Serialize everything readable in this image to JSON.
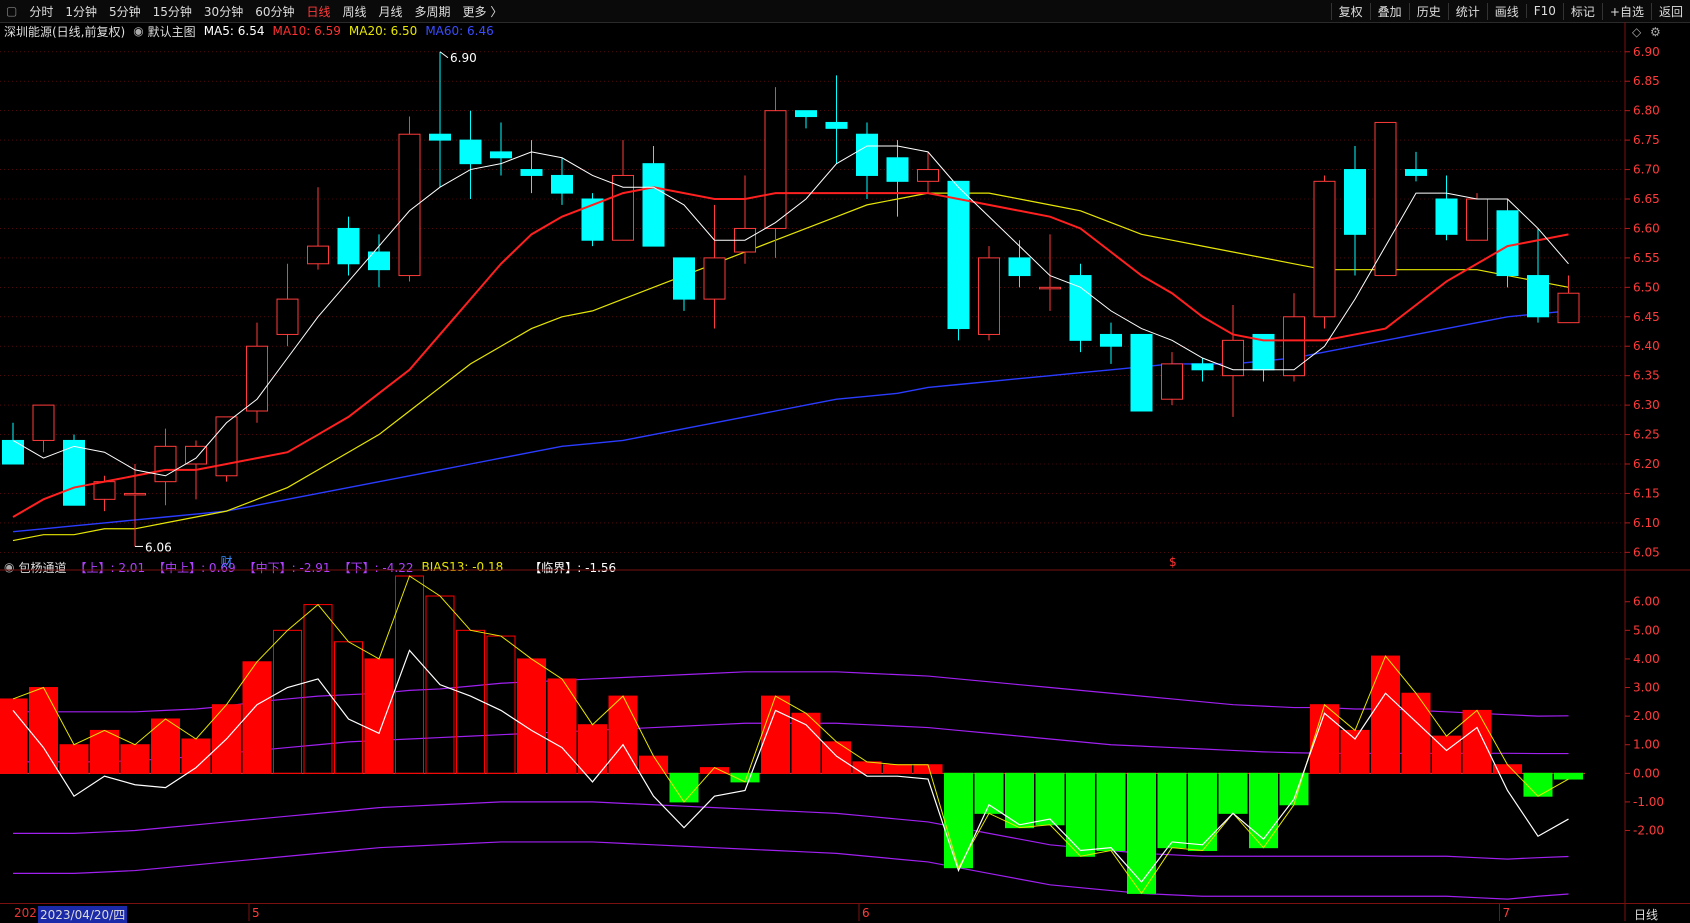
{
  "toolbar": {
    "periods": [
      "分时",
      "1分钟",
      "5分钟",
      "15分钟",
      "30分钟",
      "60分钟",
      "日线",
      "周线",
      "月线",
      "多周期",
      "更多 〉"
    ],
    "active": "日线",
    "right": [
      "复权",
      "叠加",
      "历史",
      "统计",
      "画线",
      "F10",
      "标记",
      "+自选",
      "返回"
    ]
  },
  "legend_main": {
    "name": "深圳能源(日线,前复权)",
    "main_label": "默认主图",
    "ma5": "MA5: 6.54",
    "ma10": "MA10: 6.59",
    "ma20": "MA20: 6.50",
    "ma60": "MA60: 6.46"
  },
  "legend_sub": {
    "name": "包杨通道",
    "up": "【上】: 2.01",
    "midup": "【中上】: 0.69",
    "middown": "【中下】: -2.91",
    "down": "【下】: -4.22",
    "bias": "BIAS13: -0.18",
    "critical": "【临界】: -1.56"
  },
  "dates": {
    "start": "202",
    "selected": "2023/04/20/四",
    "ticks": [
      "5",
      "6",
      "7"
    ],
    "mode": "日线"
  },
  "marks": {
    "high": "6.90",
    "low": "6.06",
    "fin": "财",
    "div": "$"
  },
  "colors": {
    "up": "#ff3b3b",
    "down": "#00ffff",
    "ma5": "#ffffff",
    "ma10": "#ff2020",
    "ma20": "#e6e600",
    "ma60": "#2a3cff",
    "bar_pos": "#ff0000",
    "bar_neg": "#00ff00",
    "band": "#a020f0"
  },
  "chart_data": [
    {
      "type": "candlestick",
      "yticks": [
        "6.90",
        "6.85",
        "6.80",
        "6.75",
        "6.70",
        "6.65",
        "6.60",
        "6.55",
        "6.50",
        "6.45",
        "6.40",
        "6.35",
        "6.30",
        "6.25",
        "6.20",
        "6.15",
        "6.10",
        "6.05"
      ],
      "ylim": [
        6.02,
        6.92
      ],
      "candles": [
        [
          6.24,
          6.2,
          6.27,
          6.2
        ],
        [
          6.24,
          6.3,
          6.3,
          6.22
        ],
        [
          6.24,
          6.13,
          6.25,
          6.13
        ],
        [
          6.14,
          6.17,
          6.18,
          6.12
        ],
        [
          6.15,
          6.15,
          6.2,
          6.06
        ],
        [
          6.17,
          6.23,
          6.26,
          6.13
        ],
        [
          6.2,
          6.23,
          6.24,
          6.14
        ],
        [
          6.18,
          6.28,
          6.28,
          6.17
        ],
        [
          6.29,
          6.4,
          6.44,
          6.27
        ],
        [
          6.42,
          6.48,
          6.54,
          6.4
        ],
        [
          6.54,
          6.57,
          6.67,
          6.53
        ],
        [
          6.6,
          6.54,
          6.62,
          6.52
        ],
        [
          6.56,
          6.53,
          6.59,
          6.5
        ],
        [
          6.52,
          6.76,
          6.79,
          6.51
        ],
        [
          6.76,
          6.75,
          6.9,
          6.67
        ],
        [
          6.75,
          6.71,
          6.8,
          6.65
        ],
        [
          6.73,
          6.72,
          6.78,
          6.69
        ],
        [
          6.7,
          6.69,
          6.75,
          6.66
        ],
        [
          6.69,
          6.66,
          6.72,
          6.64
        ],
        [
          6.65,
          6.58,
          6.66,
          6.57
        ],
        [
          6.58,
          6.69,
          6.75,
          6.58
        ],
        [
          6.71,
          6.57,
          6.74,
          6.57
        ],
        [
          6.55,
          6.48,
          6.55,
          6.46
        ],
        [
          6.48,
          6.55,
          6.64,
          6.43
        ],
        [
          6.56,
          6.6,
          6.69,
          6.54
        ],
        [
          6.6,
          6.8,
          6.84,
          6.55
        ],
        [
          6.8,
          6.79,
          6.8,
          6.77
        ],
        [
          6.78,
          6.77,
          6.86,
          6.71
        ],
        [
          6.76,
          6.69,
          6.78,
          6.65
        ],
        [
          6.72,
          6.68,
          6.75,
          6.62
        ],
        [
          6.68,
          6.7,
          6.73,
          6.66
        ],
        [
          6.68,
          6.43,
          6.68,
          6.41
        ],
        [
          6.42,
          6.55,
          6.57,
          6.41
        ],
        [
          6.55,
          6.52,
          6.58,
          6.5
        ],
        [
          6.5,
          6.5,
          6.59,
          6.46
        ],
        [
          6.52,
          6.41,
          6.54,
          6.39
        ],
        [
          6.42,
          6.4,
          6.44,
          6.37
        ],
        [
          6.42,
          6.29,
          6.42,
          6.29
        ],
        [
          6.31,
          6.37,
          6.39,
          6.3
        ],
        [
          6.37,
          6.36,
          6.38,
          6.34
        ],
        [
          6.35,
          6.41,
          6.47,
          6.28
        ],
        [
          6.42,
          6.36,
          6.42,
          6.34
        ],
        [
          6.35,
          6.45,
          6.49,
          6.34
        ],
        [
          6.45,
          6.68,
          6.69,
          6.43
        ],
        [
          6.7,
          6.59,
          6.74,
          6.52
        ],
        [
          6.52,
          6.78,
          6.78,
          6.52
        ],
        [
          6.7,
          6.69,
          6.73,
          6.68
        ],
        [
          6.65,
          6.59,
          6.69,
          6.58
        ],
        [
          6.58,
          6.65,
          6.66,
          6.58
        ],
        [
          6.63,
          6.52,
          6.65,
          6.5
        ],
        [
          6.52,
          6.45,
          6.6,
          6.44
        ],
        [
          6.44,
          6.49,
          6.52,
          6.44
        ]
      ],
      "ma5": [
        6.24,
        6.21,
        6.23,
        6.22,
        6.19,
        6.18,
        6.21,
        6.27,
        6.31,
        6.38,
        6.45,
        6.51,
        6.57,
        6.63,
        6.67,
        6.7,
        6.71,
        6.73,
        6.72,
        6.69,
        6.67,
        6.67,
        6.64,
        6.58,
        6.58,
        6.61,
        6.65,
        6.71,
        6.74,
        6.74,
        6.73,
        6.67,
        6.62,
        6.57,
        6.52,
        6.5,
        6.46,
        6.43,
        6.41,
        6.38,
        6.36,
        6.36,
        6.36,
        6.4,
        6.48,
        6.57,
        6.66,
        6.66,
        6.65,
        6.65,
        6.6,
        6.54
      ],
      "ma10": [
        6.11,
        6.14,
        6.16,
        6.17,
        6.18,
        6.19,
        6.19,
        6.2,
        6.21,
        6.22,
        6.25,
        6.28,
        6.32,
        6.36,
        6.42,
        6.48,
        6.54,
        6.59,
        6.62,
        6.64,
        6.66,
        6.67,
        6.66,
        6.65,
        6.65,
        6.66,
        6.66,
        6.66,
        6.66,
        6.66,
        6.66,
        6.65,
        6.64,
        6.63,
        6.62,
        6.6,
        6.56,
        6.52,
        6.49,
        6.45,
        6.42,
        6.41,
        6.41,
        6.41,
        6.42,
        6.43,
        6.47,
        6.51,
        6.54,
        6.57,
        6.58,
        6.59
      ],
      "ma20": [
        6.07,
        6.08,
        6.08,
        6.09,
        6.09,
        6.1,
        6.11,
        6.12,
        6.14,
        6.16,
        6.19,
        6.22,
        6.25,
        6.29,
        6.33,
        6.37,
        6.4,
        6.43,
        6.45,
        6.46,
        6.48,
        6.5,
        6.52,
        6.54,
        6.56,
        6.58,
        6.6,
        6.62,
        6.64,
        6.65,
        6.66,
        6.66,
        6.66,
        6.65,
        6.64,
        6.63,
        6.61,
        6.59,
        6.58,
        6.57,
        6.56,
        6.55,
        6.54,
        6.53,
        6.53,
        6.53,
        6.53,
        6.53,
        6.53,
        6.52,
        6.51,
        6.5
      ],
      "ma60": [
        6.085,
        6.09,
        6.095,
        6.1,
        6.105,
        6.11,
        6.115,
        6.12,
        6.13,
        6.14,
        6.15,
        6.16,
        6.17,
        6.18,
        6.19,
        6.2,
        6.21,
        6.22,
        6.23,
        6.235,
        6.24,
        6.25,
        6.26,
        6.27,
        6.28,
        6.29,
        6.3,
        6.31,
        6.315,
        6.32,
        6.33,
        6.335,
        6.34,
        6.345,
        6.35,
        6.355,
        6.36,
        6.365,
        6.37,
        6.37,
        6.37,
        6.375,
        6.38,
        6.39,
        6.4,
        6.41,
        6.42,
        6.43,
        6.44,
        6.45,
        6.455,
        6.46
      ]
    },
    {
      "type": "bar",
      "title": "包杨通道",
      "yticks": [
        "6.00",
        "5.00",
        "4.00",
        "3.00",
        "2.00",
        "1.00",
        "0.00",
        "-1.00",
        "-2.00"
      ],
      "ylim": [
        -4.5,
        6.9
      ],
      "bias": [
        2.6,
        3.0,
        1.0,
        1.5,
        1.0,
        1.9,
        1.2,
        2.4,
        3.9,
        5.0,
        5.9,
        4.6,
        4.0,
        6.9,
        6.2,
        5.0,
        4.8,
        4.0,
        3.3,
        1.7,
        2.7,
        0.6,
        -1.0,
        0.2,
        -0.3,
        2.7,
        2.1,
        1.1,
        0.4,
        0.3,
        0.3,
        -3.3,
        -1.4,
        -1.9,
        -1.8,
        -2.9,
        -2.7,
        -4.2,
        -2.6,
        -2.7,
        -1.4,
        -2.6,
        -1.1,
        2.4,
        1.5,
        4.1,
        2.8,
        1.3,
        2.2,
        0.3,
        -0.8,
        -0.2
      ],
      "critical": [
        2.2,
        0.9,
        -0.8,
        -0.1,
        -0.4,
        -0.5,
        0.2,
        1.2,
        2.4,
        3.0,
        3.3,
        1.9,
        1.4,
        4.3,
        3.1,
        2.7,
        2.2,
        1.5,
        0.9,
        -0.3,
        1.0,
        -0.8,
        -1.9,
        -0.8,
        -0.6,
        2.2,
        1.7,
        0.6,
        -0.1,
        -0.1,
        -0.2,
        -3.4,
        -1.1,
        -1.8,
        -1.6,
        -2.7,
        -2.6,
        -3.8,
        -2.4,
        -2.5,
        -1.4,
        -2.3,
        -0.9,
        2.1,
        1.2,
        2.8,
        1.8,
        0.8,
        1.6,
        -0.6,
        -2.2,
        -1.6
      ],
      "upper": [
        2.15,
        2.15,
        2.15,
        2.15,
        2.15,
        2.2,
        2.25,
        2.35,
        2.5,
        2.6,
        2.7,
        2.75,
        2.8,
        2.9,
        2.95,
        3.05,
        3.15,
        3.2,
        3.25,
        3.3,
        3.35,
        3.4,
        3.45,
        3.5,
        3.55,
        3.55,
        3.55,
        3.55,
        3.5,
        3.45,
        3.4,
        3.3,
        3.2,
        3.1,
        3.0,
        2.9,
        2.8,
        2.7,
        2.6,
        2.5,
        2.4,
        2.35,
        2.3,
        2.3,
        2.25,
        2.25,
        2.2,
        2.15,
        2.1,
        2.05,
        2.0,
        2.01
      ],
      "midup": [
        0.4,
        0.4,
        0.4,
        0.4,
        0.45,
        0.5,
        0.6,
        0.7,
        0.8,
        0.9,
        1.0,
        1.1,
        1.15,
        1.2,
        1.25,
        1.3,
        1.35,
        1.4,
        1.45,
        1.5,
        1.55,
        1.6,
        1.65,
        1.7,
        1.75,
        1.75,
        1.75,
        1.75,
        1.7,
        1.65,
        1.6,
        1.5,
        1.4,
        1.3,
        1.2,
        1.1,
        1.0,
        0.95,
        0.9,
        0.85,
        0.8,
        0.75,
        0.72,
        0.7,
        0.7,
        0.7,
        0.7,
        0.7,
        0.7,
        0.7,
        0.69,
        0.69
      ],
      "middown": [
        -2.1,
        -2.1,
        -2.1,
        -2.05,
        -2.0,
        -1.9,
        -1.8,
        -1.7,
        -1.6,
        -1.5,
        -1.4,
        -1.3,
        -1.2,
        -1.15,
        -1.1,
        -1.05,
        -1.0,
        -1.0,
        -1.0,
        -1.0,
        -1.05,
        -1.1,
        -1.15,
        -1.2,
        -1.25,
        -1.3,
        -1.35,
        -1.4,
        -1.5,
        -1.6,
        -1.7,
        -1.9,
        -2.1,
        -2.3,
        -2.5,
        -2.6,
        -2.7,
        -2.8,
        -2.85,
        -2.9,
        -2.9,
        -2.9,
        -2.9,
        -2.9,
        -2.9,
        -2.9,
        -2.9,
        -2.9,
        -2.95,
        -3.0,
        -2.95,
        -2.91
      ],
      "lower": [
        -3.5,
        -3.5,
        -3.5,
        -3.45,
        -3.4,
        -3.3,
        -3.2,
        -3.1,
        -3.0,
        -2.9,
        -2.8,
        -2.7,
        -2.6,
        -2.55,
        -2.5,
        -2.45,
        -2.4,
        -2.4,
        -2.4,
        -2.4,
        -2.45,
        -2.5,
        -2.55,
        -2.6,
        -2.65,
        -2.7,
        -2.75,
        -2.8,
        -2.9,
        -3.0,
        -3.1,
        -3.3,
        -3.5,
        -3.7,
        -3.9,
        -4.0,
        -4.1,
        -4.2,
        -4.25,
        -4.3,
        -4.3,
        -4.3,
        -4.3,
        -4.3,
        -4.3,
        -4.3,
        -4.3,
        -4.3,
        -4.35,
        -4.4,
        -4.3,
        -4.22
      ]
    }
  ]
}
